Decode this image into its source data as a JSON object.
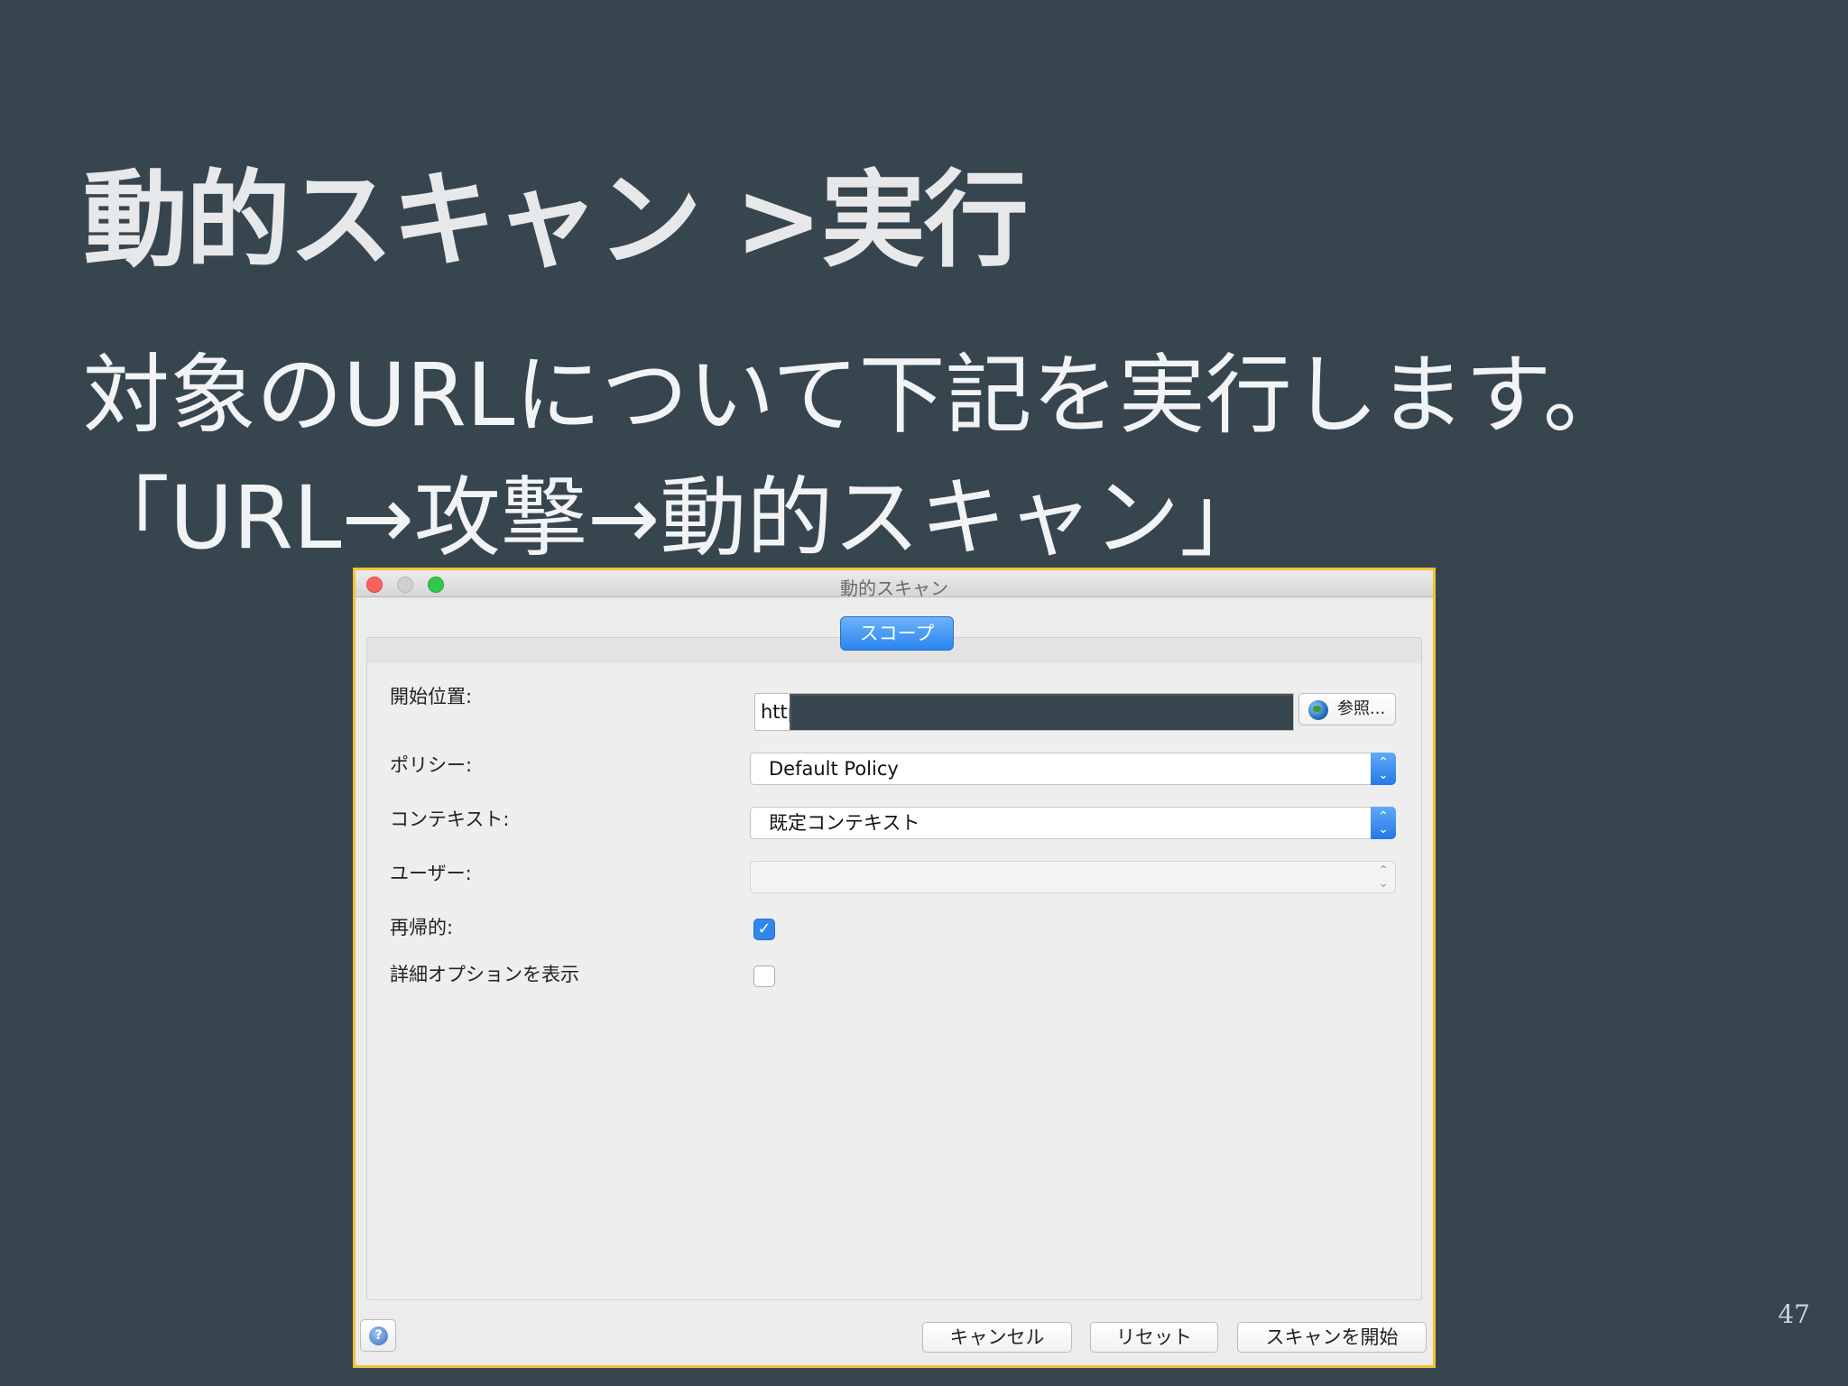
{
  "slide": {
    "title": "動的スキャン >実行",
    "body_line1": "対象のURLについて下記を実行します。",
    "body_line2": "「URL→攻撃→動的スキャン」",
    "page_number": "47"
  },
  "dialog": {
    "window_title": "動的スキャン",
    "tab_scope": "スコープ",
    "fields": {
      "start_label": "開始位置:",
      "start_value": "http",
      "browse_label": "参照...",
      "policy_label": "ポリシー:",
      "policy_value": "Default Policy",
      "context_label": "コンテキスト:",
      "context_value": "既定コンテキスト",
      "user_label": "ユーザー:",
      "user_value": "",
      "recursive_label": "再帰的:",
      "recursive_checked": true,
      "advanced_label": "詳細オプションを表示",
      "advanced_checked": false
    },
    "buttons": {
      "cancel": "キャンセル",
      "reset": "リセット",
      "start_scan": "スキャンを開始"
    }
  }
}
